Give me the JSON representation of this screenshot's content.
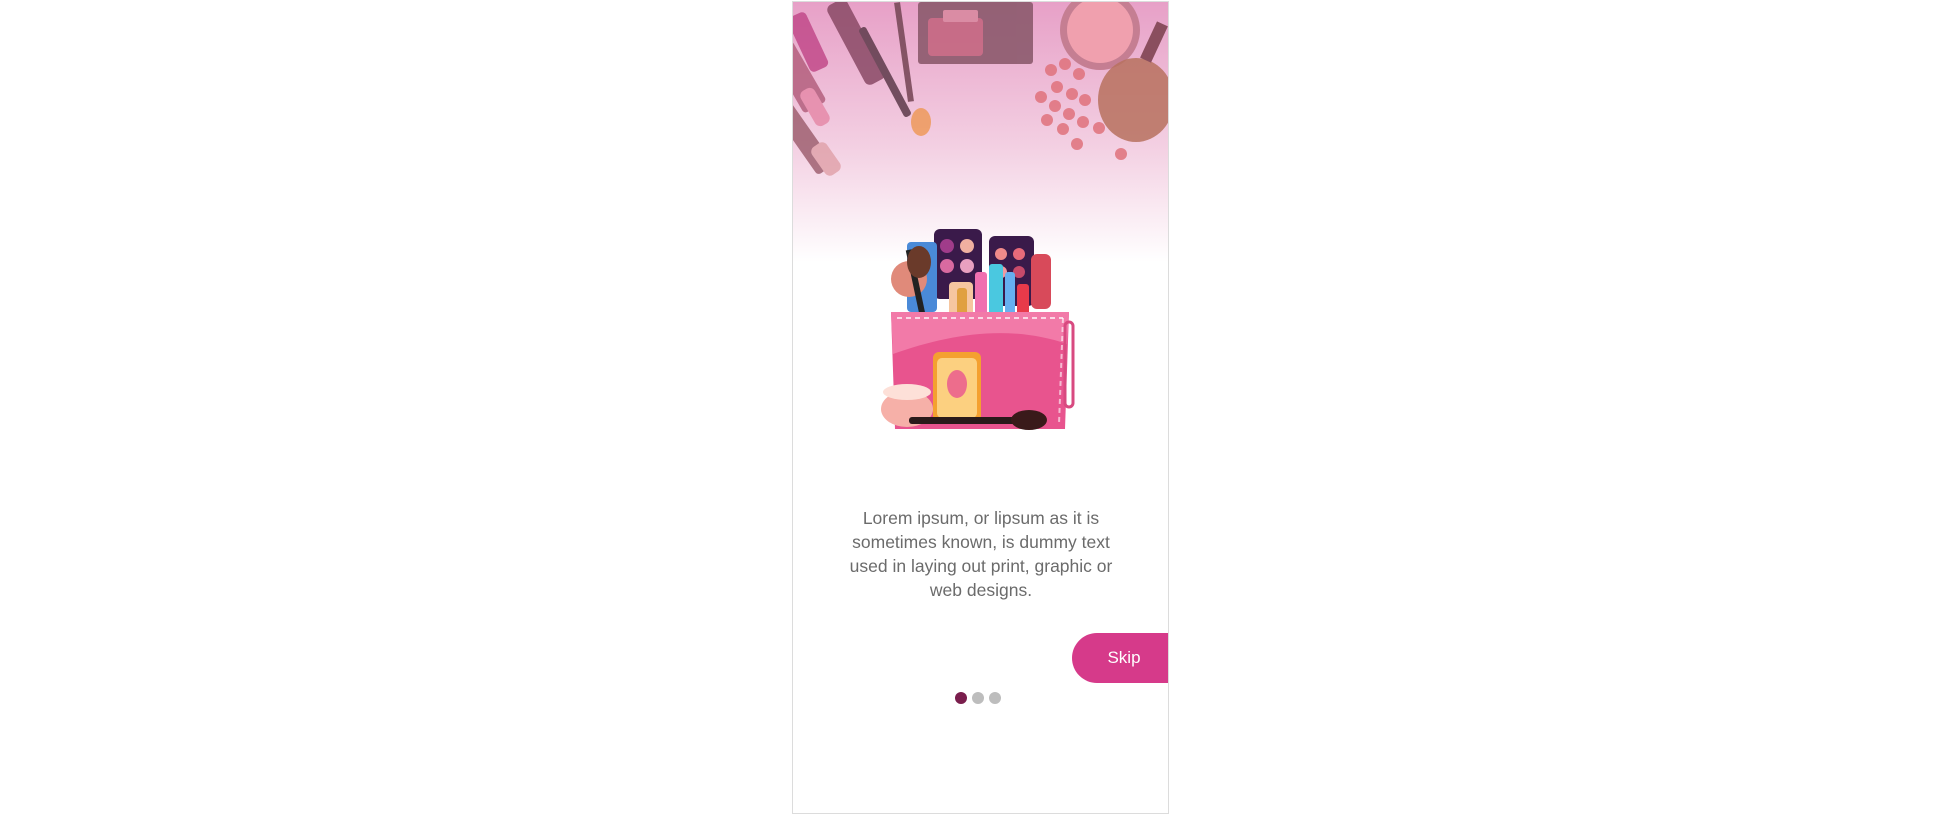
{
  "onboarding": {
    "description": "Lorem ipsum, or lipsum as it is sometimes known, is dummy text used in laying out print, graphic or web designs.",
    "skip_label": "Skip",
    "pager": {
      "total": 3,
      "current": 1
    }
  },
  "icons": {
    "hero": "makeup-flatlay-banner",
    "illustration": "cosmetic-bag-illustration"
  },
  "colors": {
    "accent": "#d63a8a",
    "active_dot": "#7a1e4d",
    "inactive_dot": "#bdbdbd",
    "text": "#6b6b6b",
    "hero_pink": "#e6a3c8"
  }
}
